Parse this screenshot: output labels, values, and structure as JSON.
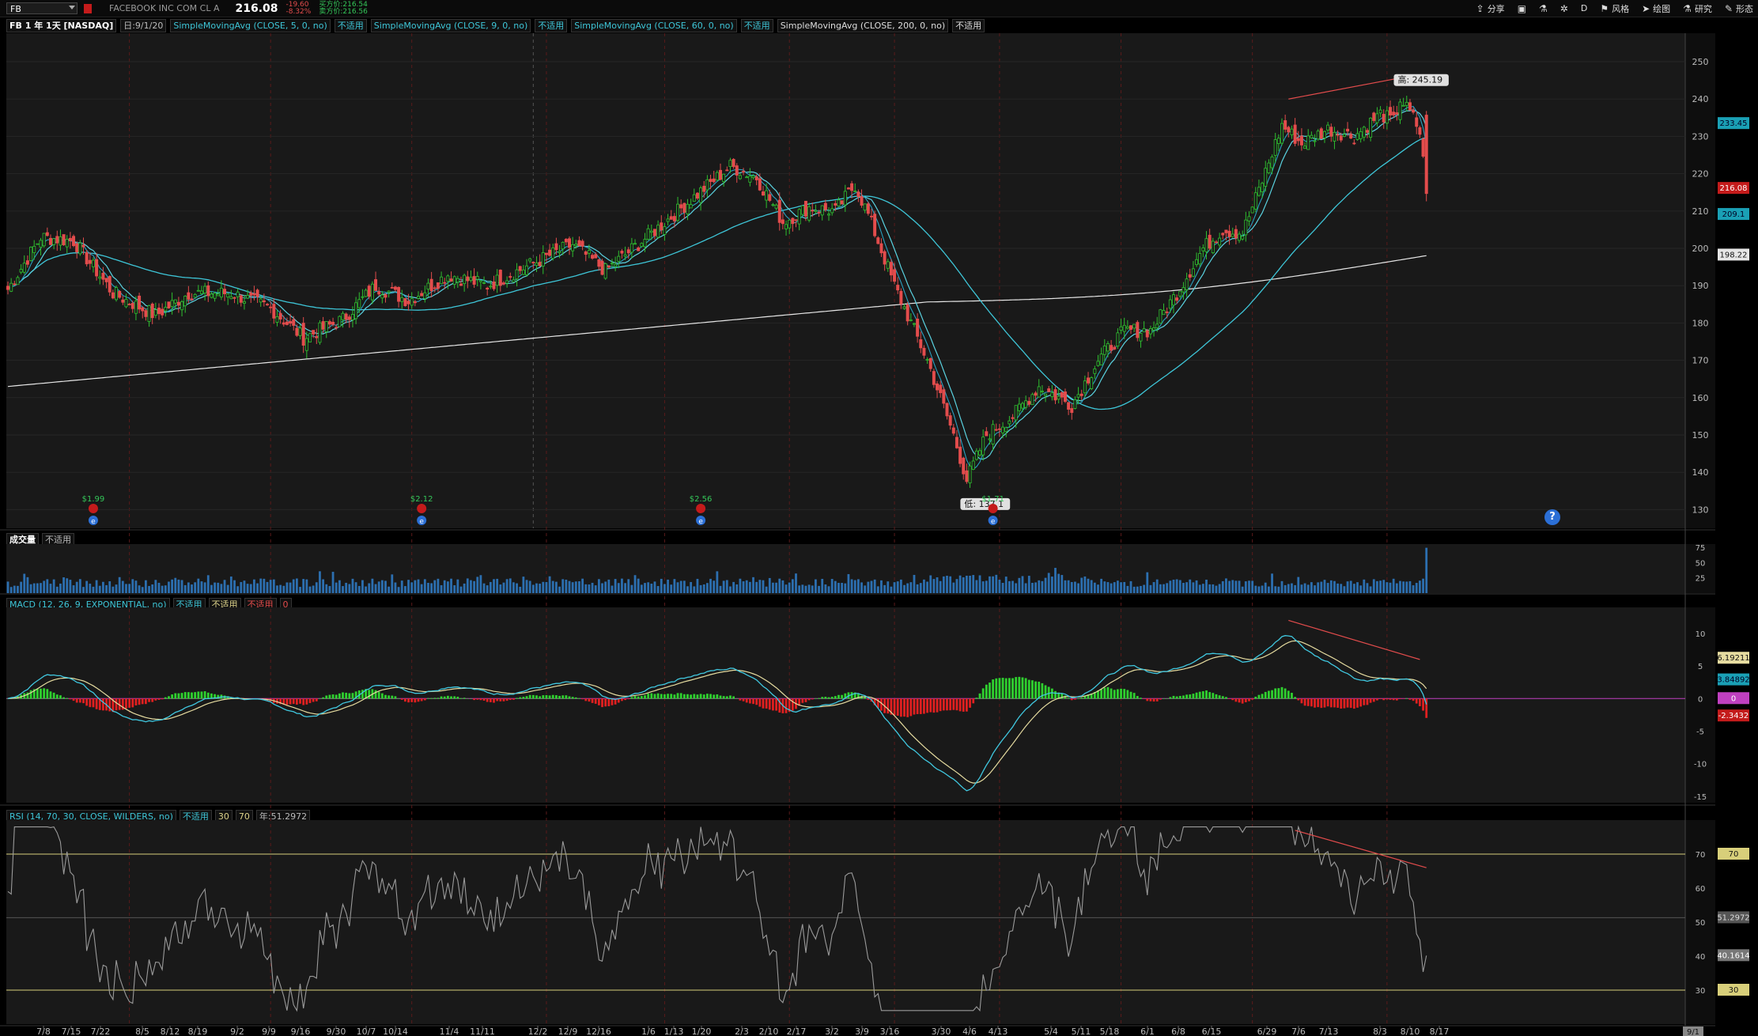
{
  "topbar": {
    "symbol": "FB",
    "company": "FACEBOOK INC COM CL A",
    "last": "216.08",
    "change": "-19.60",
    "change_pct": "-8.32%",
    "bid": "买方价:216.54",
    "ask": "卖方价:216.56",
    "tools": [
      {
        "icon": "share-icon",
        "label": "分享"
      },
      {
        "icon": "screenshot-icon",
        "label": ""
      },
      {
        "icon": "flask-icon",
        "label": ""
      },
      {
        "icon": "gear-icon",
        "label": ""
      },
      {
        "icon": "aggregation",
        "label": "D"
      },
      {
        "icon": "style-icon",
        "label": "风格"
      },
      {
        "icon": "cursor-icon",
        "label": "绘图"
      },
      {
        "icon": "research-icon",
        "label": "研究"
      },
      {
        "icon": "pattern-icon",
        "label": "形态"
      }
    ]
  },
  "study_bar": {
    "title": "FB 1 年 1天 [NASDAQ]",
    "date": "日:9/1/20",
    "sma5": "SimpleMovingAvg (CLOSE, 5, 0, no)",
    "sma9": "SimpleMovingAvg (CLOSE, 9, 0, no)",
    "sma60": "SimpleMovingAvg (CLOSE, 60, 0, no)",
    "sma200": "SimpleMovingAvg (CLOSE, 200, 0, no)",
    "na": "不适用"
  },
  "logo": "facebook",
  "volume_title": "成交量",
  "macd_title": "MACD (12, 26, 9, EXPONENTIAL, no)",
  "macd_zero": "0",
  "rsi_title": "RSI (14, 70, 30, CLOSE, WILDERS, no)",
  "rsi_tags": [
    "30",
    "70",
    "年:51.2972"
  ],
  "help": "?",
  "chart_data": [
    {
      "type": "candlestick",
      "title": "FB 1 年 1天 [NASDAQ]",
      "ylim": [
        125,
        257
      ],
      "y_ticks": [
        130,
        140,
        150,
        160,
        170,
        180,
        190,
        200,
        210,
        220,
        230,
        240,
        250
      ],
      "x_ticks": [
        "7/8",
        "7/15",
        "7/22",
        "8/5",
        "8/12",
        "8/19",
        "9/2",
        "9/9",
        "9/16",
        "9/30",
        "10/7",
        "10/14",
        "11/4",
        "11/11",
        "12/2",
        "12/9",
        "12/16",
        "1/6",
        "1/13",
        "1/20",
        "2/3",
        "2/10",
        "2/17",
        "3/2",
        "3/9",
        "3/16",
        "3/30",
        "4/6",
        "4/13",
        "5/4",
        "5/11",
        "5/18",
        "6/1",
        "6/8",
        "6/15",
        "6/29",
        "7/6",
        "7/13",
        "8/3",
        "8/10",
        "8/17",
        "9/1"
      ],
      "anchors": [
        [
          0,
          189
        ],
        [
          10,
          203
        ],
        [
          20,
          202
        ],
        [
          32,
          188
        ],
        [
          45,
          182
        ],
        [
          55,
          188
        ],
        [
          68,
          188
        ],
        [
          80,
          184
        ],
        [
          90,
          176
        ],
        [
          102,
          181
        ],
        [
          112,
          190
        ],
        [
          122,
          186
        ],
        [
          134,
          193
        ],
        [
          146,
          190
        ],
        [
          160,
          196
        ],
        [
          172,
          201
        ],
        [
          182,
          194
        ],
        [
          196,
          204
        ],
        [
          208,
          213
        ],
        [
          220,
          222
        ],
        [
          228,
          219
        ],
        [
          236,
          207
        ],
        [
          244,
          211
        ],
        [
          252,
          210
        ],
        [
          258,
          217
        ],
        [
          262,
          209
        ],
        [
          270,
          190
        ],
        [
          280,
          170
        ],
        [
          288,
          150
        ],
        [
          292,
          138
        ],
        [
          298,
          150
        ],
        [
          306,
          155
        ],
        [
          314,
          163
        ],
        [
          324,
          158
        ],
        [
          332,
          170
        ],
        [
          340,
          178
        ],
        [
          348,
          178
        ],
        [
          356,
          188
        ],
        [
          364,
          200
        ],
        [
          370,
          205
        ],
        [
          376,
          204
        ],
        [
          382,
          218
        ],
        [
          388,
          233
        ],
        [
          394,
          228
        ],
        [
          402,
          232
        ],
        [
          410,
          230
        ],
        [
          418,
          236
        ],
        [
          422,
          234
        ],
        [
          424,
          240
        ],
        [
          428,
          235
        ],
        [
          430,
          231
        ],
        [
          432,
          216
        ]
      ],
      "high_marker": "高: 245.19",
      "low_marker": "低: 137.1",
      "dividend_labels": [
        "$1.99",
        "$2.12",
        "$2.56",
        "$1.71"
      ],
      "earnings_marker": "e",
      "series_values": {
        "sma5_last": "233.45",
        "last_price": "216.08",
        "sma60_last": "209.1",
        "sma200_last": "198.22"
      },
      "x_axis_end_label": "9/1"
    },
    {
      "type": "bar",
      "title": "成交量",
      "y_ticks": [
        25,
        50,
        75
      ],
      "note": "daily volume in millions, last bar ~74M"
    },
    {
      "type": "line",
      "title": "MACD (12, 26, 9, EXPONENTIAL, no)",
      "ylim": [
        -16,
        14
      ],
      "y_ticks": [
        10,
        5,
        0,
        -5,
        -10,
        -15
      ],
      "last_values": {
        "value": "6.19211",
        "avg": "3.84892",
        "zero": "0",
        "diff": "-2.3432"
      }
    },
    {
      "type": "line",
      "title": "RSI (14, 70, 30, CLOSE, WILDERS, no)",
      "ylim": [
        20,
        80
      ],
      "y_ticks": [
        30,
        40,
        50,
        60,
        70
      ],
      "last_values": {
        "rsi": "40.1614",
        "mid": "51.2972",
        "ob": "70",
        "os": "30"
      }
    }
  ],
  "colors": {
    "up": "#2fbf2f",
    "down": "#e34c4c",
    "sma_fast": "#5ad2e0",
    "sma_slow": "#3ec6d8",
    "sma200": "#e6e6e6",
    "macd": "#40c8e0",
    "signal": "#e6dca0",
    "rsi_ob": "#f07070",
    "rsi_os": "#40c8e0",
    "rsi_line": "#9a9a9a",
    "trend": "#e34c4c",
    "grid": "#333"
  }
}
